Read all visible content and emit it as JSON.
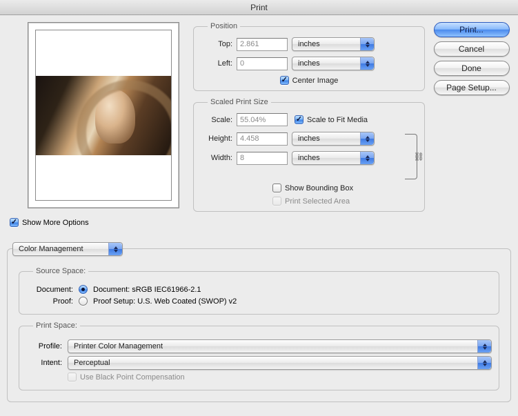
{
  "window": {
    "title": "Print"
  },
  "buttons": {
    "print": "Print...",
    "cancel": "Cancel",
    "done": "Done",
    "page_setup": "Page Setup..."
  },
  "position": {
    "legend": "Position",
    "top_label": "Top:",
    "top_value": "2.861",
    "top_units": "inches",
    "left_label": "Left:",
    "left_value": "0",
    "left_units": "inches",
    "center_image_label": "Center Image"
  },
  "scaled": {
    "legend": "Scaled Print Size",
    "scale_label": "Scale:",
    "scale_value": "55.04%",
    "fit_media_label": "Scale to Fit Media",
    "height_label": "Height:",
    "height_value": "4.458",
    "height_units": "inches",
    "width_label": "Width:",
    "width_value": "8",
    "width_units": "inches",
    "show_bbox_label": "Show Bounding Box",
    "print_selected_label": "Print Selected Area"
  },
  "show_more_label": "Show More Options",
  "color_mgmt": {
    "tab_label": "Color Management",
    "source_legend": "Source Space:",
    "document_label": "Document:",
    "document_value": "Document:  sRGB IEC61966-2.1",
    "proof_label": "Proof:",
    "proof_value": "Proof Setup:  U.S. Web Coated (SWOP) v2",
    "print_legend": "Print Space:",
    "profile_label": "Profile:",
    "profile_value": "Printer Color Management",
    "intent_label": "Intent:",
    "intent_value": "Perceptual",
    "bpc_label": "Use Black Point Compensation"
  }
}
